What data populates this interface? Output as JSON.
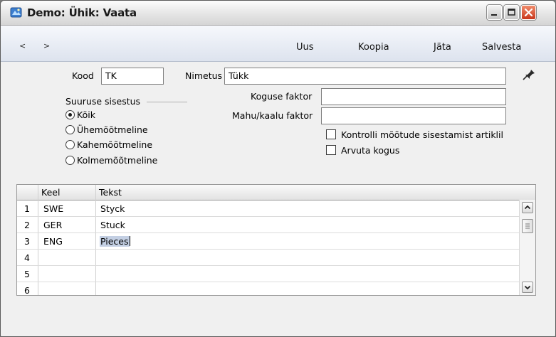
{
  "window": {
    "title": "Demo: Ühik: Vaata",
    "controls": [
      "minimize-icon",
      "maximize-icon",
      "close-icon"
    ]
  },
  "toolbar": {
    "prev": "<",
    "next": ">",
    "buttons": [
      "Uus",
      "Koopia",
      "Jäta",
      "Salvesta"
    ]
  },
  "form": {
    "kood_label": "Kood",
    "kood_value": "TK",
    "nimetus_label": "Nimetus",
    "nimetus_value": "Tükk",
    "koguse_faktor_label": "Koguse faktor",
    "koguse_faktor_value": "",
    "mahu_kaalu_faktor_label": "Mahu/kaalu faktor",
    "mahu_kaalu_faktor_value": "",
    "suuruse_sisestus_label": "Suuruse sisestus",
    "radios": [
      {
        "label": "Kõik",
        "checked": true
      },
      {
        "label": "Ühemõõtmeline",
        "checked": false
      },
      {
        "label": "Kahemõõtmeline",
        "checked": false
      },
      {
        "label": "Kolmemõõtmeline",
        "checked": false
      }
    ],
    "checkboxes": [
      {
        "label": "Kontrolli mõõtude sisestamist artiklil",
        "checked": false
      },
      {
        "label": "Arvuta kogus",
        "checked": false
      }
    ],
    "pin_icon": "pin-icon"
  },
  "grid": {
    "headers": [
      "",
      "Keel",
      "Tekst"
    ],
    "rows": [
      {
        "n": "1",
        "keel": "SWE",
        "tekst": "Styck"
      },
      {
        "n": "2",
        "keel": "GER",
        "tekst": "Stuck"
      },
      {
        "n": "3",
        "keel": "ENG",
        "tekst": "Pieces"
      },
      {
        "n": "4",
        "keel": "",
        "tekst": ""
      },
      {
        "n": "5",
        "keel": "",
        "tekst": ""
      },
      {
        "n": "6",
        "keel": "",
        "tekst": ""
      }
    ]
  },
  "colors": {
    "window_bg": "#f0f0f0",
    "toolbar_bg": "#dde3ee",
    "close_button": "#c8361b",
    "selection": "#c3cfe3"
  }
}
